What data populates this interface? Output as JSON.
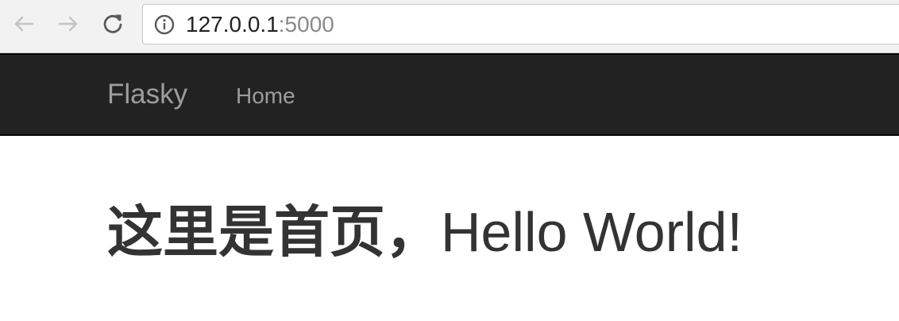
{
  "browser": {
    "url_host": "127.0.0.1",
    "url_port": ":5000",
    "icons": {
      "back": "arrow-left-icon",
      "forward": "arrow-right-icon",
      "reload": "reload-icon",
      "site_info": "info-circle-icon"
    },
    "colors": {
      "toolbar_background": "#f2f2f2",
      "url_host": "#222222",
      "url_port": "#8a8a8a"
    }
  },
  "navbar": {
    "brand": "Flasky",
    "links": [
      {
        "label": "Home"
      }
    ],
    "colors": {
      "background": "#222222",
      "text": "#9d9d9d"
    }
  },
  "main": {
    "heading_cjk": "这里是首页，",
    "heading_latin": "Hello World!",
    "heading_color": "#333333"
  }
}
